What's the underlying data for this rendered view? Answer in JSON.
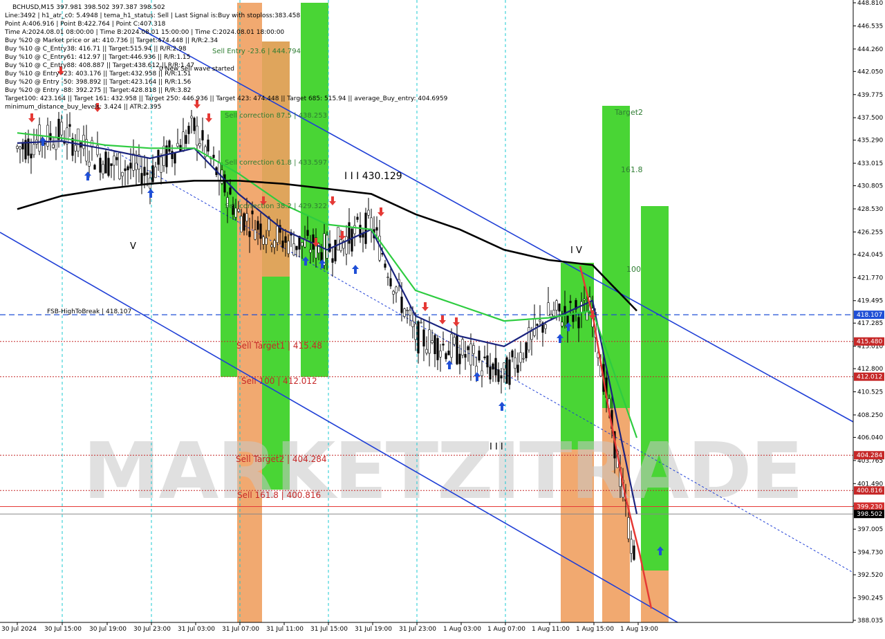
{
  "header": {
    "lines": [
      "BCHUSD,M15   397.981  398.502  397.387  398.502",
      "Line:3492  |  h1_atr_c0: 5.4948  |  tema_h1_status: Sell  |  Last Signal is:Buy with stoploss:383.458",
      "Point A:406.916  |  Point B:422.764  |  Point C:407.318",
      "Time A:2024.08.01 08:00:00  |  Time B:2024.08.01 15:00:00  |  Time C:2024.08.01 18:00:00",
      "Buy %20 @ Market price or at: 410.736  ||  Target:474.448  ||  R/R:2.34",
      "Buy %10 @ C_Entry38: 416.71  ||  Target:515.94  ||  R/R:2.98",
      "Buy %10 @ C_Entry61: 412.97  ||  Target:446.936  ||  R/R:1.15",
      "Buy %10 @ C_Entry88: 408.887  ||  Target:438.612  ||  R/R:1.47",
      "Buy %10 @ Entry -23: 403.176  ||  Target:432.958  ||  R/R:1.51",
      "Buy %20 @ Entry -50: 398.892  ||  Target:423.164  ||  R/R:1.56",
      "Buy %20 @ Entry -88: 392.275  ||  Target:428.818  ||  R/R:3.82",
      "Target100: 423.164  ||  Target 161: 432.958  ||  Target 250: 446.936  ||  Target 423: 474.448  ||  Target 685: 515.94  ||  average_Buy_entry: 404.6959",
      "minimum_distance_buy_levels: 3.424  ||  ATR:2.395"
    ],
    "wave_note": "0 New Sell wave started"
  },
  "watermark": "MARKETZITRADE",
  "price_axis": {
    "ticks": [
      "448.810",
      "446.535",
      "444.260",
      "442.050",
      "439.775",
      "437.500",
      "435.290",
      "433.015",
      "430.805",
      "428.530",
      "426.255",
      "424.045",
      "421.770",
      "419.495",
      "417.285",
      "415.010",
      "412.800",
      "410.525",
      "408.250",
      "406.040",
      "403.765",
      "401.490",
      "399.280",
      "397.005",
      "394.730",
      "392.520",
      "390.245",
      "388.035"
    ],
    "tags": [
      {
        "label": "418.107",
        "value": 418.107,
        "bg": "#1f4fd6"
      },
      {
        "label": "415.480",
        "value": 415.48,
        "bg": "#c62828"
      },
      {
        "label": "412.012",
        "value": 412.012,
        "bg": "#c62828"
      },
      {
        "label": "404.284",
        "value": 404.284,
        "bg": "#c62828"
      },
      {
        "label": "400.816",
        "value": 400.816,
        "bg": "#c62828"
      },
      {
        "label": "399.230",
        "value": 399.23,
        "bg": "#d32f2f"
      },
      {
        "label": "398.502",
        "value": 398.502,
        "bg": "#000000"
      }
    ]
  },
  "time_axis": [
    "30 Jul 2024",
    "30 Jul 15:00",
    "30 Jul 19:00",
    "30 Jul 23:00",
    "31 Jul 03:00",
    "31 Jul 07:00",
    "31 Jul 11:00",
    "31 Jul 15:00",
    "31 Jul 19:00",
    "31 Jul 23:00",
    "1 Aug 03:00",
    "1 Aug 07:00",
    "1 Aug 11:00",
    "1 Aug 15:00",
    "1 Aug 19:00"
  ],
  "levels": [
    {
      "name": "FSB-HighToBreak",
      "label": "FSB-HighToBreak | 418.107",
      "value": 418.107,
      "color": "#1f4fd6"
    },
    {
      "name": "Sell Target1",
      "label": "Sell Target1 | 415.48",
      "value": 415.48,
      "color": "#c62828"
    },
    {
      "name": "Sell 100",
      "label": "Sell 100 | 412.012",
      "value": 412.012,
      "color": "#c62828"
    },
    {
      "name": "Sell Target2",
      "label": "Sell Target2 | 404.284",
      "value": 404.284,
      "color": "#c62828"
    },
    {
      "name": "Sell 161.8",
      "label": "Sell 161.8 | 400.816",
      "value": 400.816,
      "color": "#c62828"
    }
  ],
  "zone_labels": [
    {
      "text": "Sell Entry -23.6 | 444.794",
      "value": 444.794,
      "color": "#2e7d32"
    },
    {
      "text": "Sell correction 87.5 | 438.253",
      "value": 438.253,
      "color": "#2e7d32"
    },
    {
      "text": "Sell correction 61.8 | 433.597",
      "value": 433.597,
      "color": "#2e7d32"
    },
    {
      "text": "Sell correction 38.2 | 429.322",
      "value": 429.322,
      "color": "#2e7d32"
    },
    {
      "text": "I I I  430.129",
      "value": 430.129,
      "color": "#000000"
    },
    {
      "text": "Target2",
      "value": 437.5,
      "color": "#2e7d32"
    },
    {
      "text": "161.8",
      "value": 433.0,
      "color": "#2e7d32"
    },
    {
      "text": "100",
      "value": 422.5,
      "color": "#2e7d32"
    }
  ],
  "wave_marks": [
    "V",
    "I V",
    "I I I"
  ],
  "chart_data": {
    "type": "line",
    "symbol": "BCHUSD",
    "timeframe": "M15",
    "ohlc_last": {
      "open": 397.981,
      "high": 398.502,
      "low": 397.387,
      "close": 398.502
    },
    "ylim": [
      388.035,
      448.81
    ],
    "x": [
      "30 Jul 2024",
      "30 Jul 15:00",
      "30 Jul 19:00",
      "30 Jul 23:00",
      "31 Jul 03:00",
      "31 Jul 07:00",
      "31 Jul 11:00",
      "31 Jul 15:00",
      "31 Jul 19:00",
      "31 Jul 23:00",
      "1 Aug 03:00",
      "1 Aug 07:00",
      "1 Aug 11:00",
      "1 Aug 15:00",
      "1 Aug 19:00"
    ],
    "series": [
      {
        "name": "price",
        "color": "#000000",
        "values": [
          434.5,
          436.0,
          433.2,
          432.0,
          436.5,
          428.0,
          425.5,
          424.5,
          427.0,
          416.0,
          414.5,
          412.0,
          418.0,
          418.5,
          392.5
        ]
      },
      {
        "name": "ema_fast",
        "color": "#1a237e",
        "values": [
          435.0,
          435.2,
          434.4,
          433.5,
          434.5,
          430.0,
          426.5,
          424.5,
          426.5,
          418.0,
          416.0,
          415.0,
          417.5,
          419.5,
          398.5
        ]
      },
      {
        "name": "ema_mid",
        "color": "#2ecc40",
        "values": [
          436.0,
          435.5,
          434.8,
          434.5,
          434.5,
          432.0,
          429.0,
          427.0,
          426.5,
          420.5,
          419.0,
          417.5,
          417.8,
          418.5,
          406.0
        ]
      },
      {
        "name": "ema_slow",
        "color": "#000000",
        "values": [
          428.5,
          429.8,
          430.5,
          431.0,
          431.3,
          431.3,
          431.0,
          430.5,
          430.0,
          428.0,
          426.5,
          424.5,
          423.5,
          423.0,
          418.5
        ]
      }
    ]
  },
  "colors": {
    "buy_arrow": "#1f4fd6",
    "sell_arrow": "#e53935",
    "bright_green": "#35d01f",
    "orange": "#f0a060"
  }
}
